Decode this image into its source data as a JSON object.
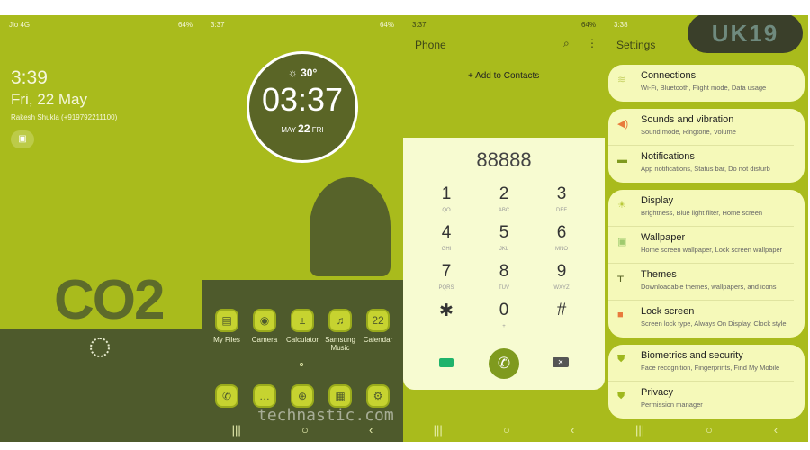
{
  "colors": {
    "lime": "#a9bb1c",
    "olive": "#4e5a2c",
    "pale": "#f7fbd1",
    "card": "#f5f9b9",
    "accent_orange": "#e87a3c",
    "video": "#1fb36b"
  },
  "lock": {
    "carrier": "Jio 4G",
    "battery": "64%",
    "time": "3:39",
    "date": "Fri, 22 May",
    "owner": "Rakesh Shukla (+919792211100)",
    "art_text": "CO2"
  },
  "home": {
    "status_time": "3:37",
    "battery": "64%",
    "weather_temp": "30°",
    "clock": "03:37",
    "date_month": "MAY",
    "date_day": "22",
    "date_weekday": "FRI",
    "apps": [
      {
        "label": "My Files",
        "icon": "folder-icon"
      },
      {
        "label": "Camera",
        "icon": "camera-icon"
      },
      {
        "label": "Calculator",
        "icon": "calculator-icon"
      },
      {
        "label": "Samsung Music",
        "icon": "music-icon"
      },
      {
        "label": "Calendar",
        "icon": "calendar-icon",
        "glyph": "22"
      }
    ],
    "dock": [
      {
        "icon": "phone-icon"
      },
      {
        "icon": "messages-icon"
      },
      {
        "icon": "internet-icon"
      },
      {
        "icon": "gallery-icon"
      },
      {
        "icon": "settings-icon"
      }
    ],
    "watermark": "technastic.com"
  },
  "phone": {
    "status_time": "3:37",
    "battery": "64%",
    "title": "Phone",
    "add_contacts": "+ Add to Contacts",
    "number": "88888",
    "keys": [
      {
        "n": "1",
        "l": "QO"
      },
      {
        "n": "2",
        "l": "ABC"
      },
      {
        "n": "3",
        "l": "DEF"
      },
      {
        "n": "4",
        "l": "GHI"
      },
      {
        "n": "5",
        "l": "JKL"
      },
      {
        "n": "6",
        "l": "MNO"
      },
      {
        "n": "7",
        "l": "PQRS"
      },
      {
        "n": "8",
        "l": "TUV"
      },
      {
        "n": "9",
        "l": "WXYZ"
      },
      {
        "n": "✱",
        "l": ""
      },
      {
        "n": "0",
        "l": "+"
      },
      {
        "n": "#",
        "l": ""
      }
    ]
  },
  "settings": {
    "status_time": "3:38",
    "title": "Settings",
    "logo": "UK19",
    "items": [
      {
        "t": "Connections",
        "s": "Wi-Fi, Bluetooth, Flight mode, Data usage",
        "icon": "wifi-icon"
      },
      {
        "t": "Sounds and vibration",
        "s": "Sound mode, Ringtone, Volume",
        "icon": "speaker-icon"
      },
      {
        "t": "Notifications",
        "s": "App notifications, Status bar, Do not disturb",
        "icon": "notification-icon"
      },
      {
        "t": "Display",
        "s": "Brightness, Blue light filter, Home screen",
        "icon": "brightness-icon"
      },
      {
        "t": "Wallpaper",
        "s": "Home screen wallpaper, Lock screen wallpaper",
        "icon": "wallpaper-icon"
      },
      {
        "t": "Themes",
        "s": "Downloadable themes, wallpapers, and icons",
        "icon": "brush-icon"
      },
      {
        "t": "Lock screen",
        "s": "Screen lock type, Always On Display, Clock style",
        "icon": "lock-icon"
      },
      {
        "t": "Biometrics and security",
        "s": "Face recognition, Fingerprints, Find My Mobile",
        "icon": "shield-icon"
      },
      {
        "t": "Privacy",
        "s": "Permission manager",
        "icon": "privacy-icon"
      }
    ]
  }
}
